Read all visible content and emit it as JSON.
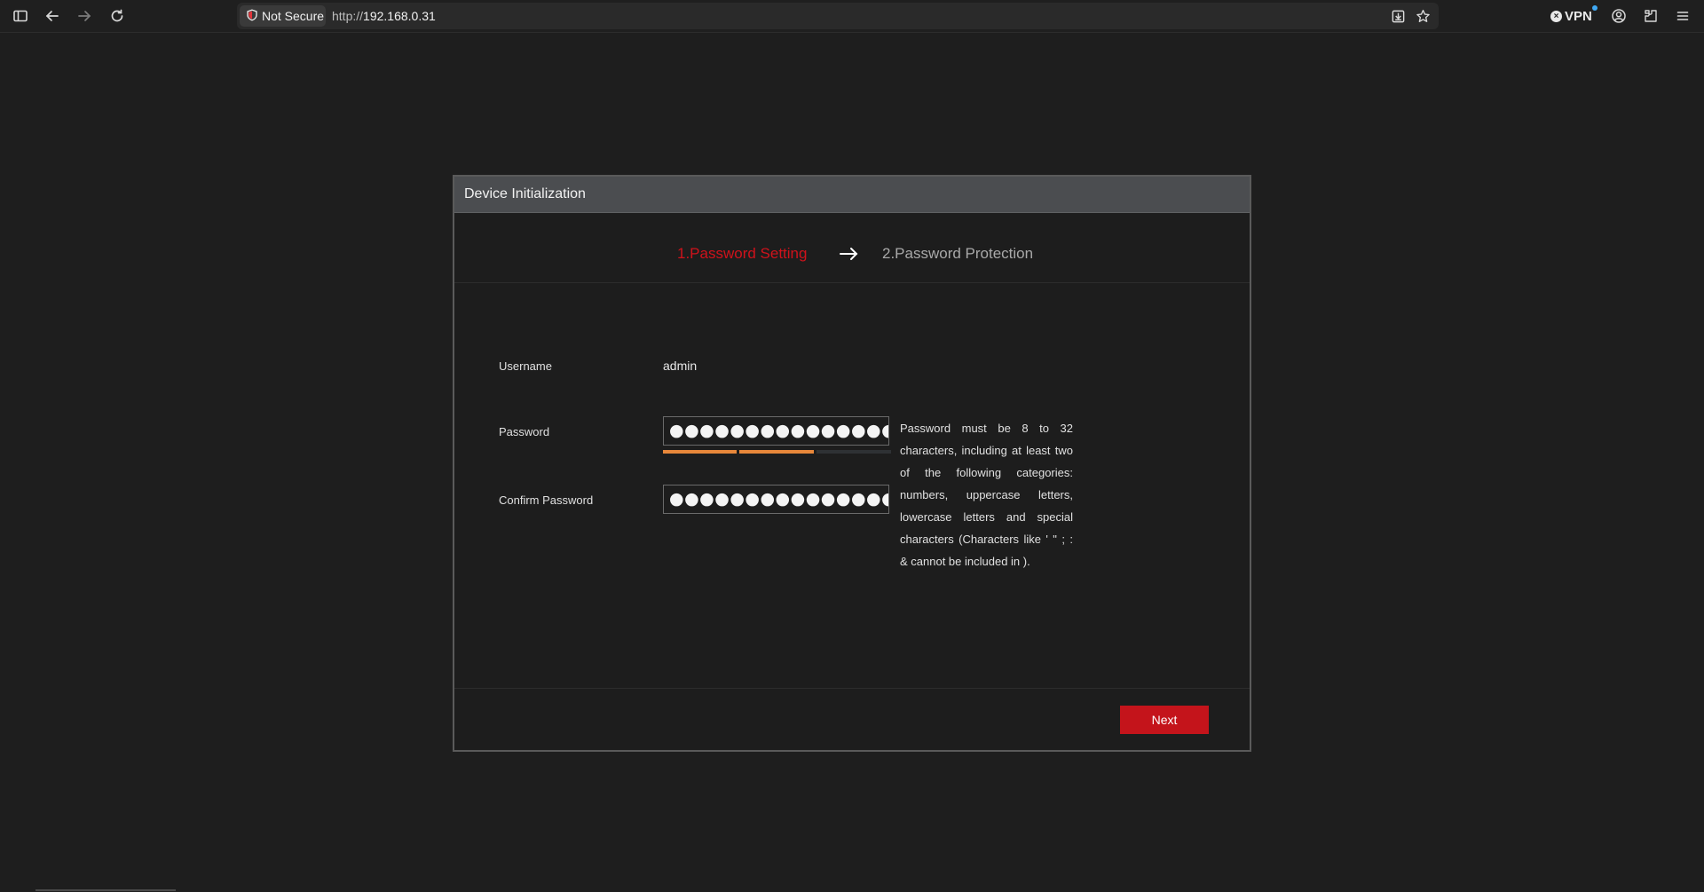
{
  "browser": {
    "security_label": "Not Secure",
    "url_scheme": "http://",
    "url_host": "192.168.0.31",
    "vpn_label": "VPN",
    "icons": [
      "sidebar-icon",
      "back-icon",
      "forward-icon",
      "reload-icon",
      "shield-icon",
      "install-icon",
      "bookmark-star-icon",
      "vpn-icon",
      "profile-icon",
      "extensions-icon",
      "menu-icon"
    ]
  },
  "dialog": {
    "title": "Device Initialization",
    "step1": "1.Password Setting",
    "step2": "2.Password Protection",
    "username_label": "Username",
    "username_value": "admin",
    "password_label": "Password",
    "password_mask": "●●●●●●●●●●●●●●●●●●●",
    "confirm_label": "Confirm Password",
    "confirm_mask": "●●●●●●●●●●●●●●●●●●●",
    "password_strength_level": "2 of 3",
    "hint": "Password must be 8 to 32 characters, including at least two of the following categories: numbers, uppercase letters, lowercase letters and special characters (Characters like ' \" ; : & cannot be included in ).",
    "next_label": "Next"
  },
  "colors": {
    "accent": "#c4141b",
    "active_step": "#d0121b",
    "strength": "#e8873a"
  }
}
